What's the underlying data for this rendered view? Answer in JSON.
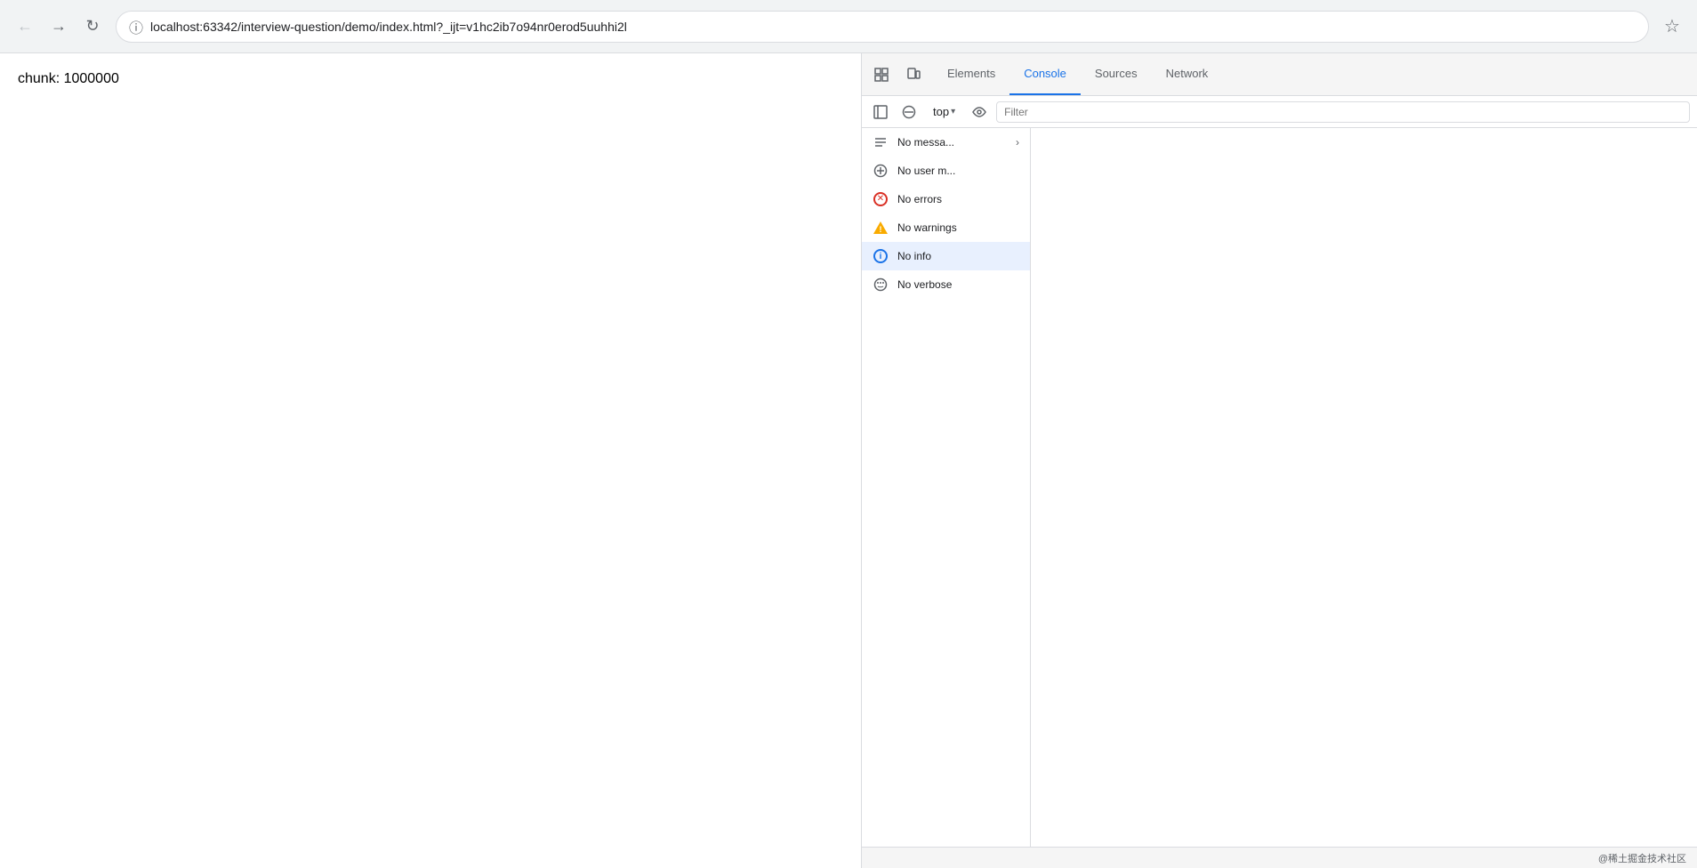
{
  "browser": {
    "url": "localhost:63342/interview-question/demo/index.html?_ijt=v1hc2ib7o94nr0erod5uuhhi2l",
    "back_btn": "←",
    "forward_btn": "→",
    "reload_btn": "↺",
    "star_label": "☆"
  },
  "page": {
    "content_text": "chunk: 1000000"
  },
  "devtools": {
    "tabs": [
      {
        "label": "Elements",
        "active": false
      },
      {
        "label": "Console",
        "active": true
      },
      {
        "label": "Sources",
        "active": false
      },
      {
        "label": "Network",
        "active": false
      }
    ],
    "toolbar": {
      "top_label": "top",
      "filter_placeholder": "Filter"
    },
    "sidebar_items": [
      {
        "id": "messages",
        "label": "No messa...",
        "icon": "messages",
        "active": false
      },
      {
        "id": "user",
        "label": "No user m...",
        "icon": "user",
        "active": false
      },
      {
        "id": "errors",
        "label": "No errors",
        "icon": "error",
        "active": false
      },
      {
        "id": "warnings",
        "label": "No warnings",
        "icon": "warning",
        "active": false
      },
      {
        "id": "info",
        "label": "No info",
        "icon": "info",
        "active": true
      },
      {
        "id": "verbose",
        "label": "No verbose",
        "icon": "verbose",
        "active": false
      }
    ]
  },
  "bottom_bar": {
    "text": "@稀土掘金技术社区"
  }
}
